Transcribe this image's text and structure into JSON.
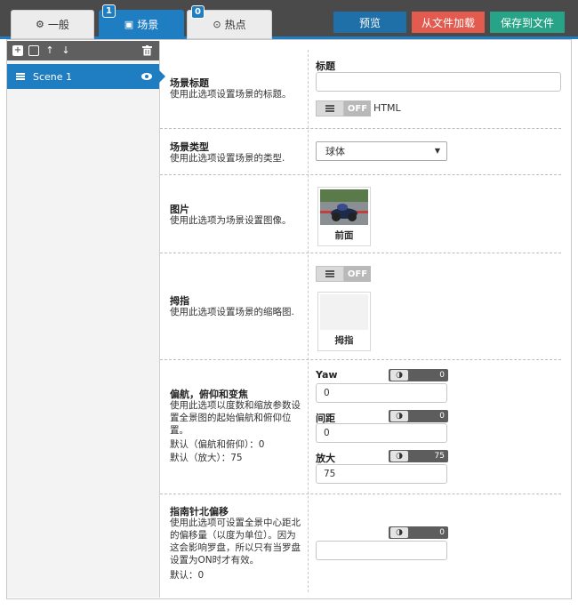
{
  "tabs": [
    {
      "label": "一般",
      "icon": "gear-icon",
      "glyph": "⚙",
      "badge": ""
    },
    {
      "label": "场景",
      "icon": "image-icon",
      "glyph": "▣",
      "badge": "1"
    },
    {
      "label": "热点",
      "icon": "target-icon",
      "glyph": "⊙",
      "badge": "0"
    }
  ],
  "toolbar": {
    "preview_label": "预览",
    "load_label": "从文件加载",
    "save_label": "保存到文件"
  },
  "sidebar": {
    "scenes": [
      {
        "label": "Scene 1"
      }
    ]
  },
  "sections": {
    "title": {
      "heading": "场景标题",
      "desc": "使用此选项设置场景的标题。",
      "field_label": "标题",
      "value": "",
      "toggle_state": "OFF",
      "toggle_label": "HTML"
    },
    "type": {
      "heading": "场景类型",
      "desc": "使用此选项设置场景的类型.",
      "selected": "球体"
    },
    "image": {
      "heading": "图片",
      "desc": "使用此选项为场景设置图像。",
      "caption": "前面"
    },
    "thumb": {
      "heading": "拇指",
      "desc": "使用此选项设置场景的缩略图.",
      "toggle_state": "OFF",
      "caption": "拇指"
    },
    "view": {
      "heading": "偏航，俯仰和变焦",
      "desc": "使用此选项以度数和缩放参数设置全景图的起始偏航和俯仰位置。",
      "default1": "默认（偏航和俯仰）：0",
      "default2": "默认（放大）：75",
      "yaw_label": "Yaw",
      "yaw_value": "0",
      "yaw_spin": "0",
      "pitch_label": "间距",
      "pitch_value": "0",
      "pitch_spin": "0",
      "zoom_label": "放大",
      "zoom_value": "75",
      "zoom_spin": "75"
    },
    "compass": {
      "heading": "指南针北偏移",
      "desc": "使用此选项可设置全景中心距北的偏移量（以度为单位）。因为这会影响罗盘，所以只有当罗盘设置为ON时才有效。",
      "default": "默认：0",
      "value": "",
      "spin": "0"
    }
  }
}
